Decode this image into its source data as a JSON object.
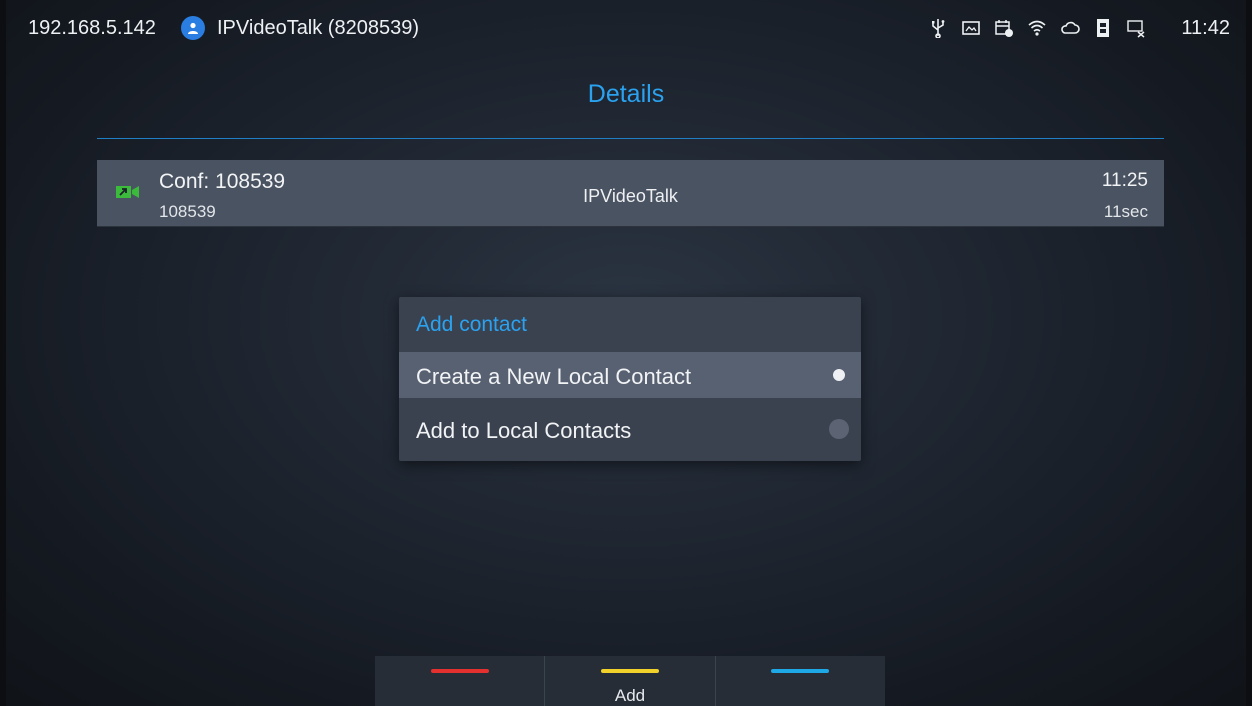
{
  "status_bar": {
    "ip": "192.168.5.142",
    "account": "IPVideoTalk (8208539)",
    "clock": "11:42",
    "icons": [
      "usb-icon",
      "screen-icon",
      "calendar-icon",
      "wifi-icon",
      "cloud-icon",
      "sim-icon",
      "network-off-icon"
    ]
  },
  "page": {
    "title": "Details"
  },
  "call": {
    "name": "Conf: 108539",
    "number": "108539",
    "account": "IPVideoTalk",
    "time": "11:25",
    "duration": "11sec"
  },
  "dialog": {
    "title": "Add contact",
    "options": [
      {
        "label": "Create a New Local Contact",
        "selected": true
      },
      {
        "label": "Add to Local Contacts",
        "selected": false
      }
    ]
  },
  "softkeys": [
    {
      "label": "",
      "color": "#e53030"
    },
    {
      "label": "Add",
      "color": "#f2d22a"
    },
    {
      "label": "",
      "color": "#1ea8e6"
    }
  ],
  "colors": {
    "accent": "#2aa2f0",
    "call_icon": "#3cba3c"
  }
}
